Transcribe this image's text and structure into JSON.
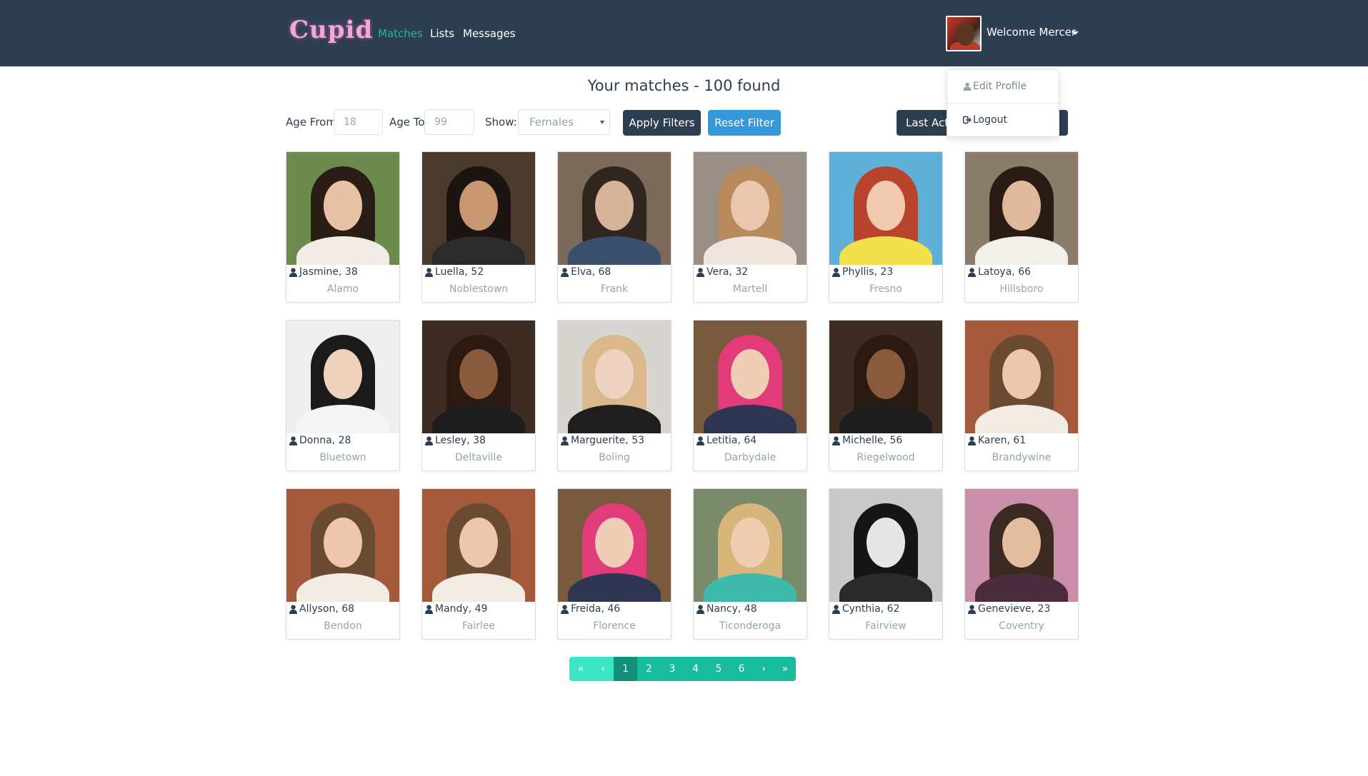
{
  "nav": {
    "brand": "Cupid",
    "links": [
      "Matches",
      "Lists",
      "Messages"
    ],
    "welcome": "Welcome Mercer"
  },
  "user_menu": {
    "items": [
      "Edit Profile",
      "Logout"
    ]
  },
  "heading": "Your matches - 100 found",
  "filters": {
    "age_from_label": "Age From",
    "age_from_value": "18",
    "age_to_label": "Age To",
    "age_to_value": "99",
    "show_label": "Show:",
    "show_value": "Females",
    "apply_label": "Apply Filters",
    "reset_label": "Reset Filter",
    "sort_label": "Last Acti"
  },
  "matches": [
    {
      "name": "Jasmine, 38",
      "city": "Alamo"
    },
    {
      "name": "Luella, 52",
      "city": "Noblestown"
    },
    {
      "name": "Elva, 68",
      "city": "Frank"
    },
    {
      "name": "Vera, 32",
      "city": "Martell"
    },
    {
      "name": "Phyllis, 23",
      "city": "Fresno"
    },
    {
      "name": "Latoya, 66",
      "city": "Hillsboro"
    },
    {
      "name": "Donna, 28",
      "city": "Bluetown"
    },
    {
      "name": "Lesley, 38",
      "city": "Deltaville"
    },
    {
      "name": "Marguerite, 53",
      "city": "Boling"
    },
    {
      "name": "Letitia, 64",
      "city": "Darbydale"
    },
    {
      "name": "Michelle, 56",
      "city": "Riegelwood"
    },
    {
      "name": "Karen, 61",
      "city": "Brandywine"
    },
    {
      "name": "Allyson, 68",
      "city": "Bendon"
    },
    {
      "name": "Mandy, 49",
      "city": "Fairlee"
    },
    {
      "name": "Freida, 46",
      "city": "Florence"
    },
    {
      "name": "Nancy, 48",
      "city": "Ticonderoga"
    },
    {
      "name": "Cynthia, 62",
      "city": "Fairview"
    },
    {
      "name": "Genevieve, 23",
      "city": "Coventry"
    }
  ],
  "pagination": {
    "first": "«",
    "prev": "‹",
    "pages": [
      "1",
      "2",
      "3",
      "4",
      "5",
      "6"
    ],
    "current": "1",
    "next": "›",
    "last": "»"
  },
  "colors": {
    "navbar": "#2c3e50",
    "accent": "#18bc9c",
    "primary": "#3498db"
  }
}
